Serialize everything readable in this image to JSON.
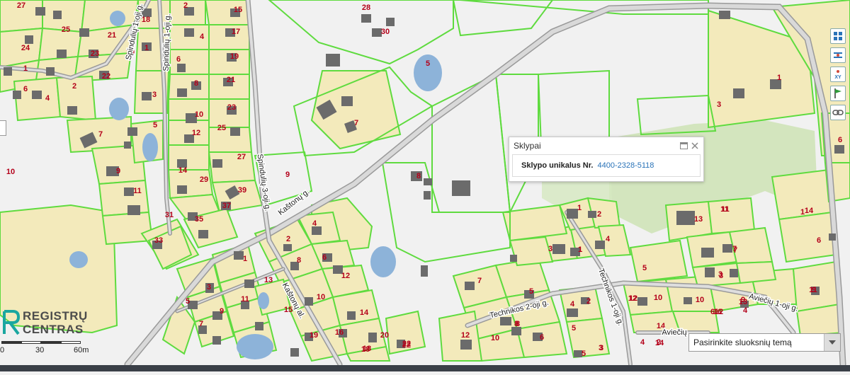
{
  "popup": {
    "title": "Sklypai",
    "key": "Sklypo unikalus Nr.",
    "value": "4400-2328-5118"
  },
  "logo": {
    "line1": "REGISTRŲ",
    "line2": "CENTRAS"
  },
  "scale": {
    "labels": [
      "0",
      "30",
      "60m"
    ]
  },
  "layer_select": {
    "placeholder": "Pasirinkite sluoksnių temą"
  },
  "streets": [
    "Spindulių 1-oji g.",
    "Spindulių 3-oji g.",
    "Kaštonų g.",
    "Kaštonų al.",
    "Technikos 2-oji g.",
    "Technikos 1-oji g.",
    "Aviečių 1-oji g.",
    "Aviečių"
  ],
  "plot_numbers": [
    "27",
    "2",
    "15",
    "28",
    "25",
    "21",
    "18",
    "4",
    "17",
    "30",
    "24",
    "1",
    "6",
    "19",
    "5",
    "23",
    "20",
    "22",
    "1",
    "8",
    "21",
    "6",
    "2",
    "4",
    "3",
    "1",
    "10",
    "23",
    "3",
    "7",
    "5",
    "12",
    "25",
    "7",
    "27",
    "9",
    "10",
    "9",
    "8",
    "14",
    "29",
    "11",
    "39",
    "37",
    "1",
    "2",
    "13",
    "31",
    "35",
    "33",
    "4",
    "2",
    "11",
    "6",
    "7",
    "1",
    "8",
    "12",
    "3",
    "10",
    "5",
    "4",
    "14",
    "13",
    "15",
    "9",
    "5",
    "7",
    "11",
    "10",
    "12",
    "7",
    "8",
    "14",
    "6",
    "12",
    "11",
    "20",
    "18",
    "16",
    "22",
    "3",
    "4",
    "2",
    "10",
    "3",
    "13",
    "11",
    "6",
    "1",
    "5",
    "6",
    "12",
    "5",
    "7",
    "3",
    "1",
    "3",
    "10",
    "8",
    "9",
    "4",
    "6",
    "4",
    "2",
    "5",
    "9",
    "12",
    "3",
    "14",
    "16",
    "1",
    "14",
    "18",
    "22",
    "19"
  ],
  "toolbar": [
    "layers-icon",
    "measure-icon",
    "xy-icon",
    "flag-icon",
    "link-icon"
  ],
  "colors": {
    "map_background": "#f1f1f1",
    "plot_fill": "#f3eabb",
    "plot_border": "#5fdb3f",
    "building": "#6b6b6b",
    "water": "#8db3d9",
    "road": "#d2d2d2",
    "forest": "#cfe3b8",
    "label": "#b4001a",
    "popup_link": "#2a73b8"
  }
}
